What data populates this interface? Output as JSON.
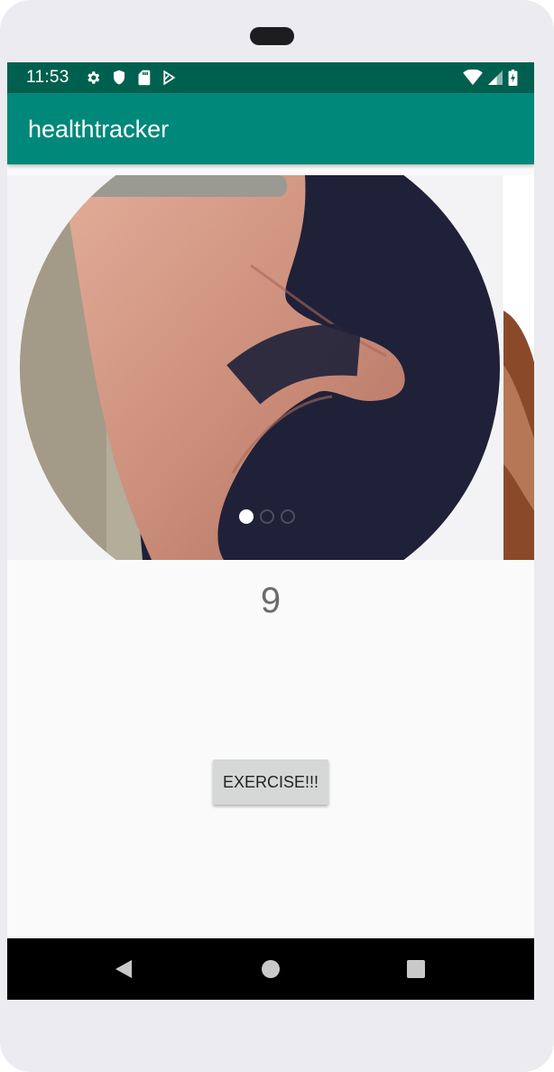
{
  "status_bar": {
    "time": "11:53",
    "left_icons": [
      "settings-icon",
      "shield-icon",
      "sd-card-icon",
      "play-protect-icon"
    ],
    "right_icons": [
      "wifi-icon",
      "cellular-signal-icon",
      "battery-charging-icon"
    ]
  },
  "app_bar": {
    "title": "healthtracker",
    "color": "#00887a",
    "status_color": "#00604f"
  },
  "carousel": {
    "slide_count": 3,
    "active_index": 0,
    "slides": [
      "hand-mudra-photo",
      "hand-photo-partial"
    ]
  },
  "counter": {
    "value": "9"
  },
  "actions": {
    "exercise_label": "EXERCISE!!!"
  },
  "nav_bar": {
    "buttons": [
      "back-icon",
      "home-icon",
      "recents-icon"
    ]
  }
}
